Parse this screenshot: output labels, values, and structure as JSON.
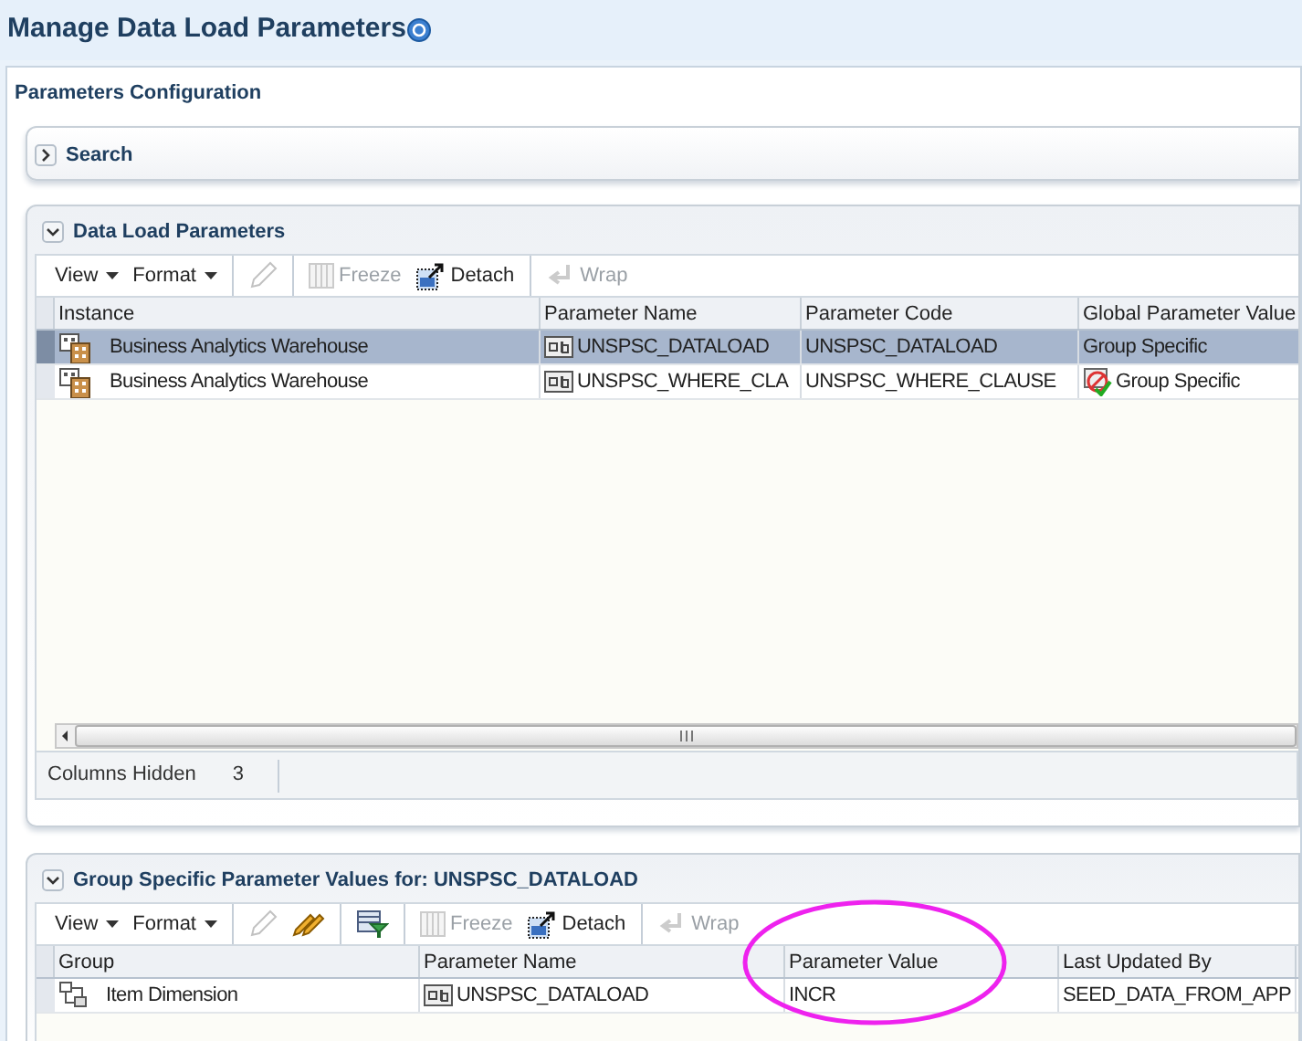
{
  "page_title": "Manage Data Load Parameters",
  "section_title": "Parameters Configuration",
  "search_panel": {
    "title": "Search",
    "expanded": false
  },
  "data_load_panel": {
    "title": "Data Load Parameters",
    "expanded": true,
    "toolbar": [
      {
        "kind": "menu",
        "label": "View"
      },
      {
        "kind": "menu",
        "label": "Format"
      },
      {
        "kind": "separator"
      },
      {
        "kind": "edit",
        "disabled": true
      },
      {
        "kind": "separator"
      },
      {
        "kind": "freeze",
        "label": "Freeze",
        "disabled": true
      },
      {
        "kind": "detach",
        "label": "Detach",
        "disabled": false
      },
      {
        "kind": "separator"
      },
      {
        "kind": "wrap",
        "label": "Wrap",
        "disabled": true
      }
    ],
    "columns": [
      "Instance",
      "Parameter Name",
      "Parameter Code",
      "Global Parameter Value"
    ],
    "rows": [
      {
        "selected": true,
        "cells": [
          {
            "kind": "instance",
            "text": "Business Analytics Warehouse"
          },
          {
            "kind": "text_param",
            "text": "UNSPSC_DATALOAD"
          },
          {
            "kind": "plain",
            "text": "UNSPSC_DATALOAD"
          },
          {
            "kind": "plain",
            "text": "Group Specific"
          }
        ]
      },
      {
        "selected": false,
        "cells": [
          {
            "kind": "instance",
            "text": "Business Analytics Warehouse"
          },
          {
            "kind": "text_param",
            "text": "UNSPSC_WHERE_CLA"
          },
          {
            "kind": "plain",
            "text": "UNSPSC_WHERE_CLAUSE"
          },
          {
            "kind": "overridden",
            "text": "Group Specific"
          }
        ]
      }
    ],
    "footer": {
      "label": "Columns Hidden",
      "value": "3"
    }
  },
  "group_panel": {
    "title": "Group Specific Parameter Values for: UNSPSC_DATALOAD",
    "expanded": true,
    "toolbar": [
      {
        "kind": "menu",
        "label": "View"
      },
      {
        "kind": "menu",
        "label": "Format"
      },
      {
        "kind": "separator"
      },
      {
        "kind": "edit",
        "disabled": true
      },
      {
        "kind": "edit_all",
        "disabled": false
      },
      {
        "kind": "separator"
      },
      {
        "kind": "filter",
        "disabled": false
      },
      {
        "kind": "separator"
      },
      {
        "kind": "freeze",
        "label": "Freeze",
        "disabled": true
      },
      {
        "kind": "detach",
        "label": "Detach",
        "disabled": false
      },
      {
        "kind": "separator"
      },
      {
        "kind": "wrap",
        "label": "Wrap",
        "disabled": true
      }
    ],
    "columns": [
      "Group",
      "Parameter Name",
      "Parameter Value",
      "Last Updated By"
    ],
    "rows": [
      {
        "selected": false,
        "cells": [
          {
            "kind": "group",
            "text": "Item Dimension"
          },
          {
            "kind": "text_param",
            "text": "UNSPSC_DATALOAD"
          },
          {
            "kind": "plain",
            "text": "INCR"
          },
          {
            "kind": "plain",
            "text": "SEED_DATA_FROM_APP"
          }
        ]
      }
    ]
  }
}
